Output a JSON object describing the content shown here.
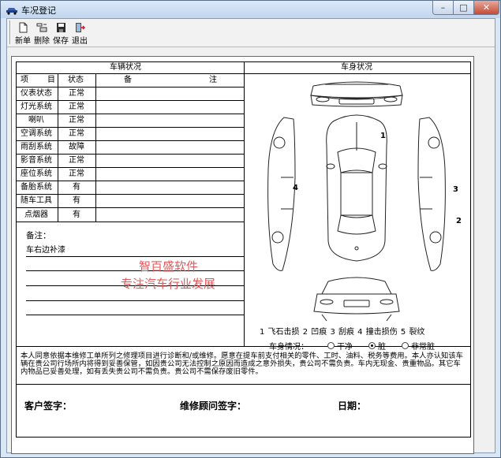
{
  "window": {
    "title": "车况登记",
    "minimize_glyph": "–",
    "maximize_glyph": "□",
    "close_glyph": "✕"
  },
  "toolbar": {
    "new_label": "新单",
    "delete_label": "删除",
    "save_label": "保存",
    "exit_label": "退出"
  },
  "form": {
    "vehicle_status_title": "车辆状况",
    "body_status_title": "车身状况",
    "headers": {
      "item_a": "项",
      "item_b": "目",
      "status": "状态",
      "remark_a": "备",
      "remark_b": "注"
    },
    "rows": [
      {
        "item": "仪表状态",
        "status": "正常"
      },
      {
        "item": "灯光系统",
        "status": "正常"
      },
      {
        "item": "喇叭",
        "status": "正常"
      },
      {
        "item": "空调系统",
        "status": "正常"
      },
      {
        "item": "雨刮系统",
        "status": "故障"
      },
      {
        "item": "影音系统",
        "status": "正常"
      },
      {
        "item": "座位系统",
        "status": "正常"
      },
      {
        "item": "备胎系统",
        "status": "有"
      },
      {
        "item": "随车工具",
        "status": "有"
      },
      {
        "item": "点烟器",
        "status": "有"
      }
    ],
    "notes_label": "备注：",
    "notes_text": "车右边补漆",
    "watermark_line1": "智百盛软件",
    "watermark_line2": "专注汽车行业发展",
    "damage_legend": "1 飞石击损   2 凹痕   3 刮痕   4 撞击损伤   5 裂纹",
    "car_markers": [
      "1",
      "2",
      "3",
      "4"
    ],
    "body_condition_label": "车身情况：",
    "body_condition_options": [
      "干净",
      "脏",
      "非常脏"
    ],
    "body_condition_selected": "脏",
    "agreement_text": "本人同意依据本维修工单所列之修理项目进行诊断和/或维修。愿意在提车前支付相关的零件、工时、油料、税务等费用。本人亦认知该车辆在贵公司行场所内将得到妥善保管，如因贵公司无法控制之原因而造成之意外损失，贵公司不需负责。车内无现金、贵重物品。其它车内物品已妥善处理，如有丢失贵公司不需负责。贵公司不需保存废旧零件。",
    "customer_signature_label": "客户签字：",
    "advisor_signature_label": "维修顾问签字：",
    "date_label": "日期："
  },
  "colors": {
    "watermark": "#e3595c",
    "window_frame": "#d9e6f4",
    "close_button": "#c44a35"
  },
  "icons": [
    "car-app-icon",
    "new-document-icon",
    "delete-icon",
    "save-disk-icon",
    "exit-door-icon"
  ]
}
